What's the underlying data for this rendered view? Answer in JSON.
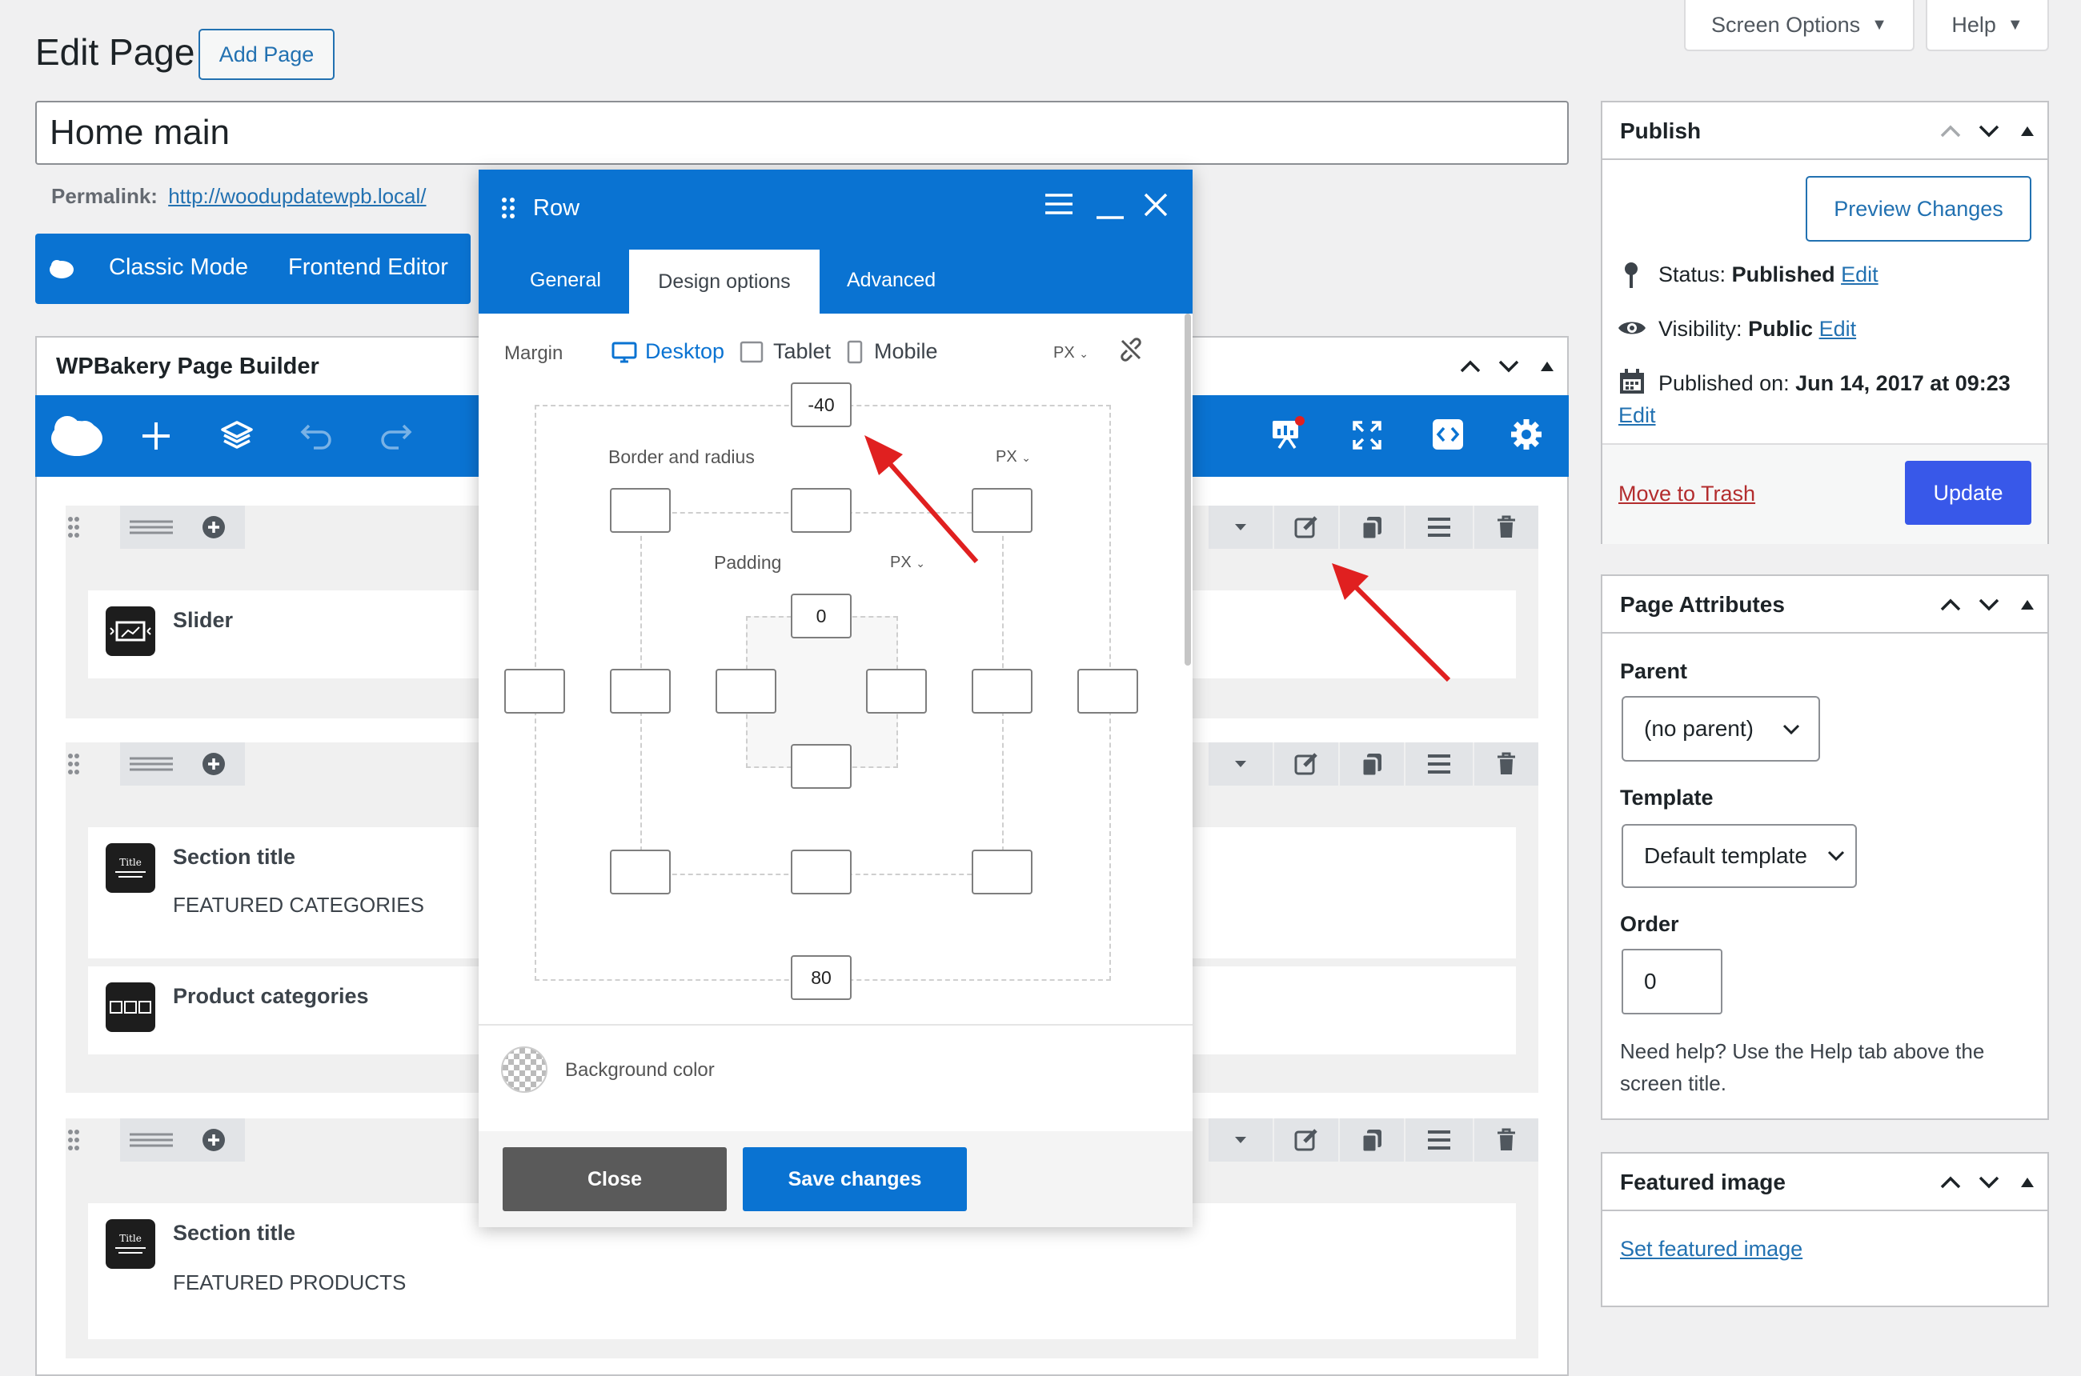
{
  "header": {
    "title": "Edit Page",
    "add_page": "Add Page",
    "screen_options": "Screen Options",
    "help": "Help"
  },
  "post": {
    "title_value": "Home main",
    "permalink_label": "Permalink:",
    "permalink_url": "http://woodupdatewpb.local/"
  },
  "mode_bar": {
    "classic": "Classic Mode",
    "frontend": "Frontend Editor"
  },
  "builder": {
    "title": "WPBakery Page Builder",
    "rows": [
      {
        "elements": [
          {
            "title": "Slider",
            "subtitle": ""
          }
        ]
      },
      {
        "elements": [
          {
            "title": "Section title",
            "subtitle": "FEATURED CATEGORIES"
          },
          {
            "title": "Product categories",
            "subtitle": ""
          }
        ]
      },
      {
        "elements": [
          {
            "title": "Section title",
            "subtitle": "FEATURED PRODUCTS"
          }
        ]
      }
    ]
  },
  "modal": {
    "title": "Row",
    "tabs": [
      "General",
      "Design options",
      "Advanced"
    ],
    "active_tab": "Design options",
    "margin_label": "Margin",
    "devices": [
      "Desktop",
      "Tablet",
      "Mobile"
    ],
    "unit": "PX",
    "border_label": "Border and radius",
    "padding_label": "Padding",
    "margin_top": "-40",
    "margin_bottom": "80",
    "padding_top": "0",
    "background_label": "Background color",
    "close_label": "Close",
    "save_label": "Save changes"
  },
  "publish": {
    "title": "Publish",
    "preview": "Preview Changes",
    "status_label": "Status:",
    "status_value": "Published",
    "visibility_label": "Visibility:",
    "visibility_value": "Public",
    "published_label": "Published on:",
    "published_value": "Jun 14, 2017 at 09:23",
    "edit": "Edit",
    "trash": "Move to Trash",
    "update": "Update"
  },
  "attributes": {
    "title": "Page Attributes",
    "parent_label": "Parent",
    "parent_value": "(no parent)",
    "template_label": "Template",
    "template_value": "Default template",
    "order_label": "Order",
    "order_value": "0",
    "help_text": "Need help? Use the Help tab above the screen title."
  },
  "featured": {
    "title": "Featured image",
    "set": "Set featured image"
  },
  "colors": {
    "wp_blue": "#2271b1",
    "wpb_blue": "#0a73d2",
    "update_blue": "#3858e9",
    "trash_red": "#b32d2e",
    "arrow_red": "#e02020"
  }
}
